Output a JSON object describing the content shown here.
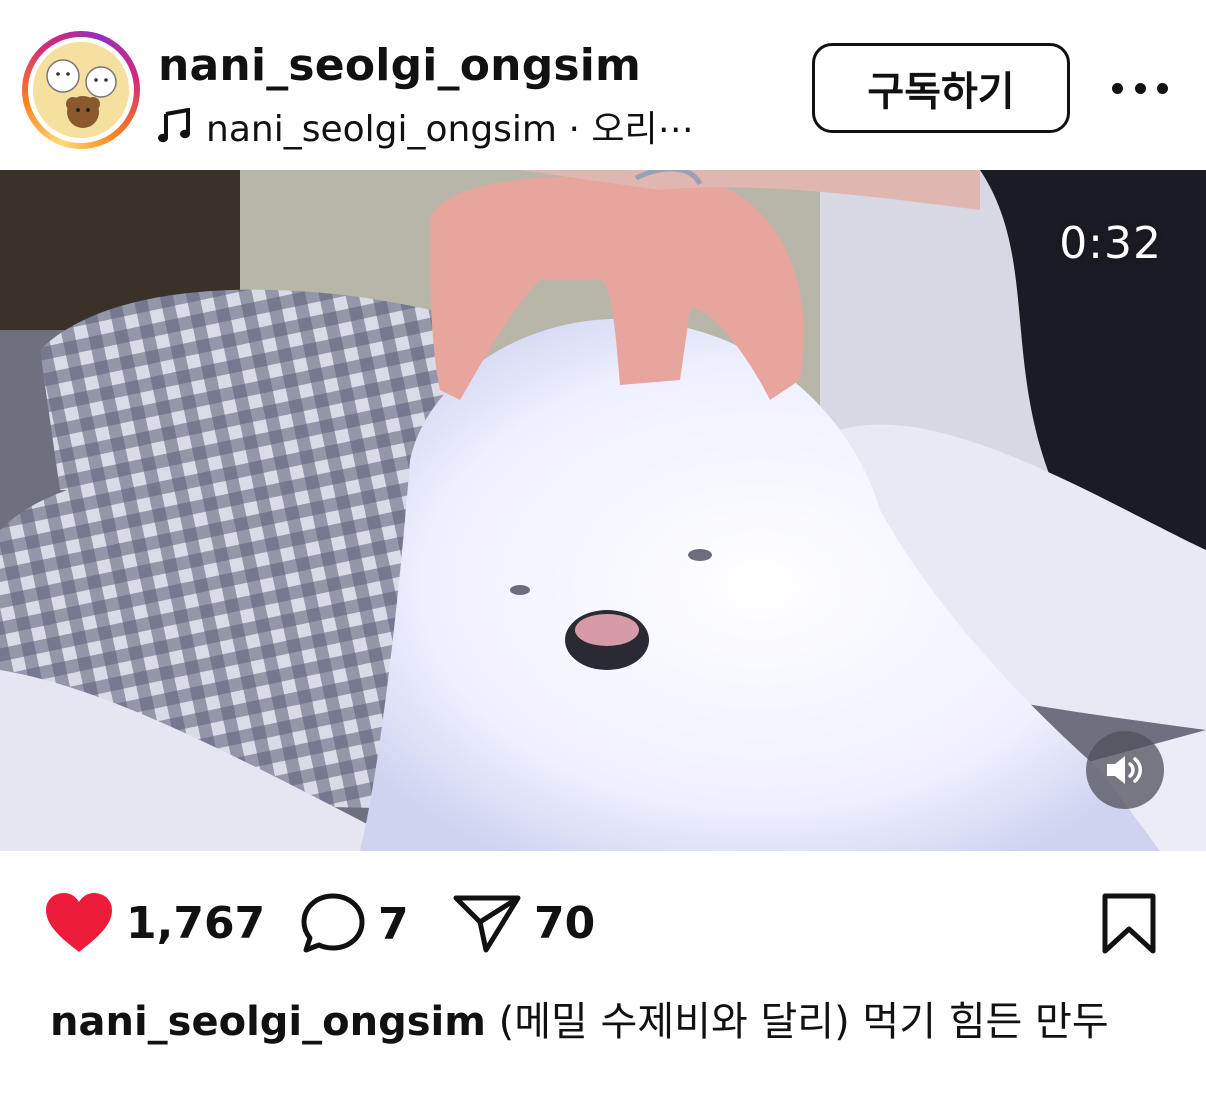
{
  "header": {
    "username": "nani_seolgi_ongsim",
    "music_label": "nani_seolgi_ongsim · 오리⋯",
    "subscribe_label": "구독하기",
    "avatar_icon": "profile-avatar",
    "music_icon": "music-note-icon",
    "more_icon": "more-horizontal-icon"
  },
  "video": {
    "timestamp": "0:32",
    "sound_icon": "speaker-icon"
  },
  "actions": {
    "likes": "1,767",
    "comments": "7",
    "shares": "70",
    "like_color": "#ed1c3a"
  },
  "caption": {
    "username": "nani_seolgi_ongsim",
    "text": "(메밀 수제비와 달리) 먹기 힘든 만두"
  }
}
